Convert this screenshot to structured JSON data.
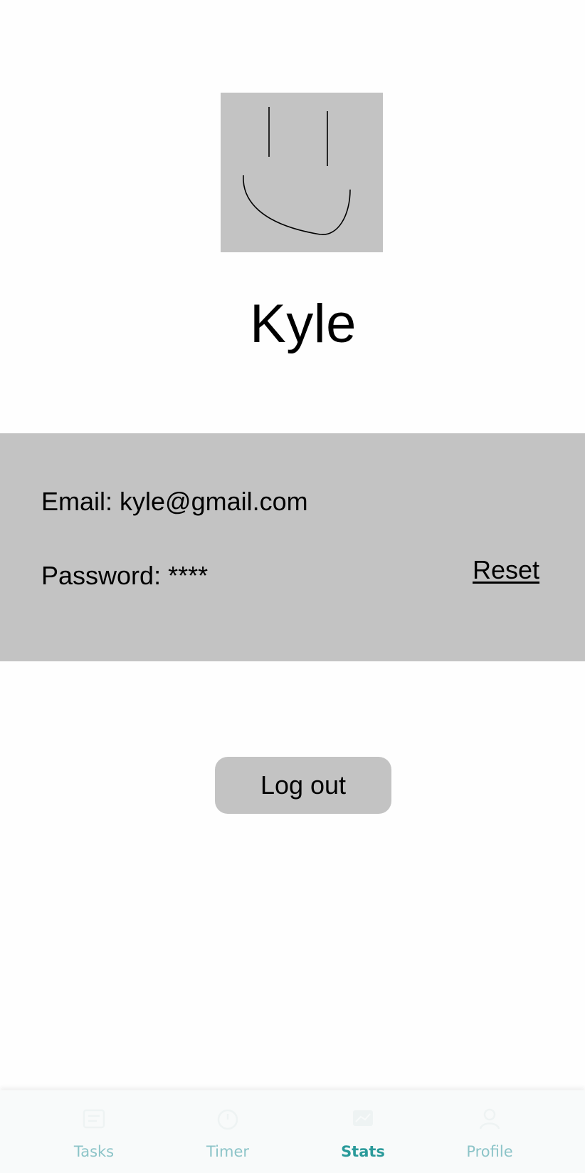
{
  "profile": {
    "name": "Kyle",
    "avatar_icon": "smiley-drawing-icon"
  },
  "account": {
    "email_text": "Email: kyle@gmail.com",
    "password_text": "Password: ****",
    "reset_label": "Reset"
  },
  "actions": {
    "logout_label": "Log out"
  },
  "bottom_nav": {
    "active": "Stats",
    "inactive_color": "#8cc4c8",
    "active_color": "#2a9a9a",
    "items": [
      {
        "label": "Tasks",
        "icon": "tasks-icon"
      },
      {
        "label": "Timer",
        "icon": "timer-icon"
      },
      {
        "label": "Stats",
        "icon": "stats-icon"
      },
      {
        "label": "Profile",
        "icon": "profile-icon"
      }
    ]
  }
}
